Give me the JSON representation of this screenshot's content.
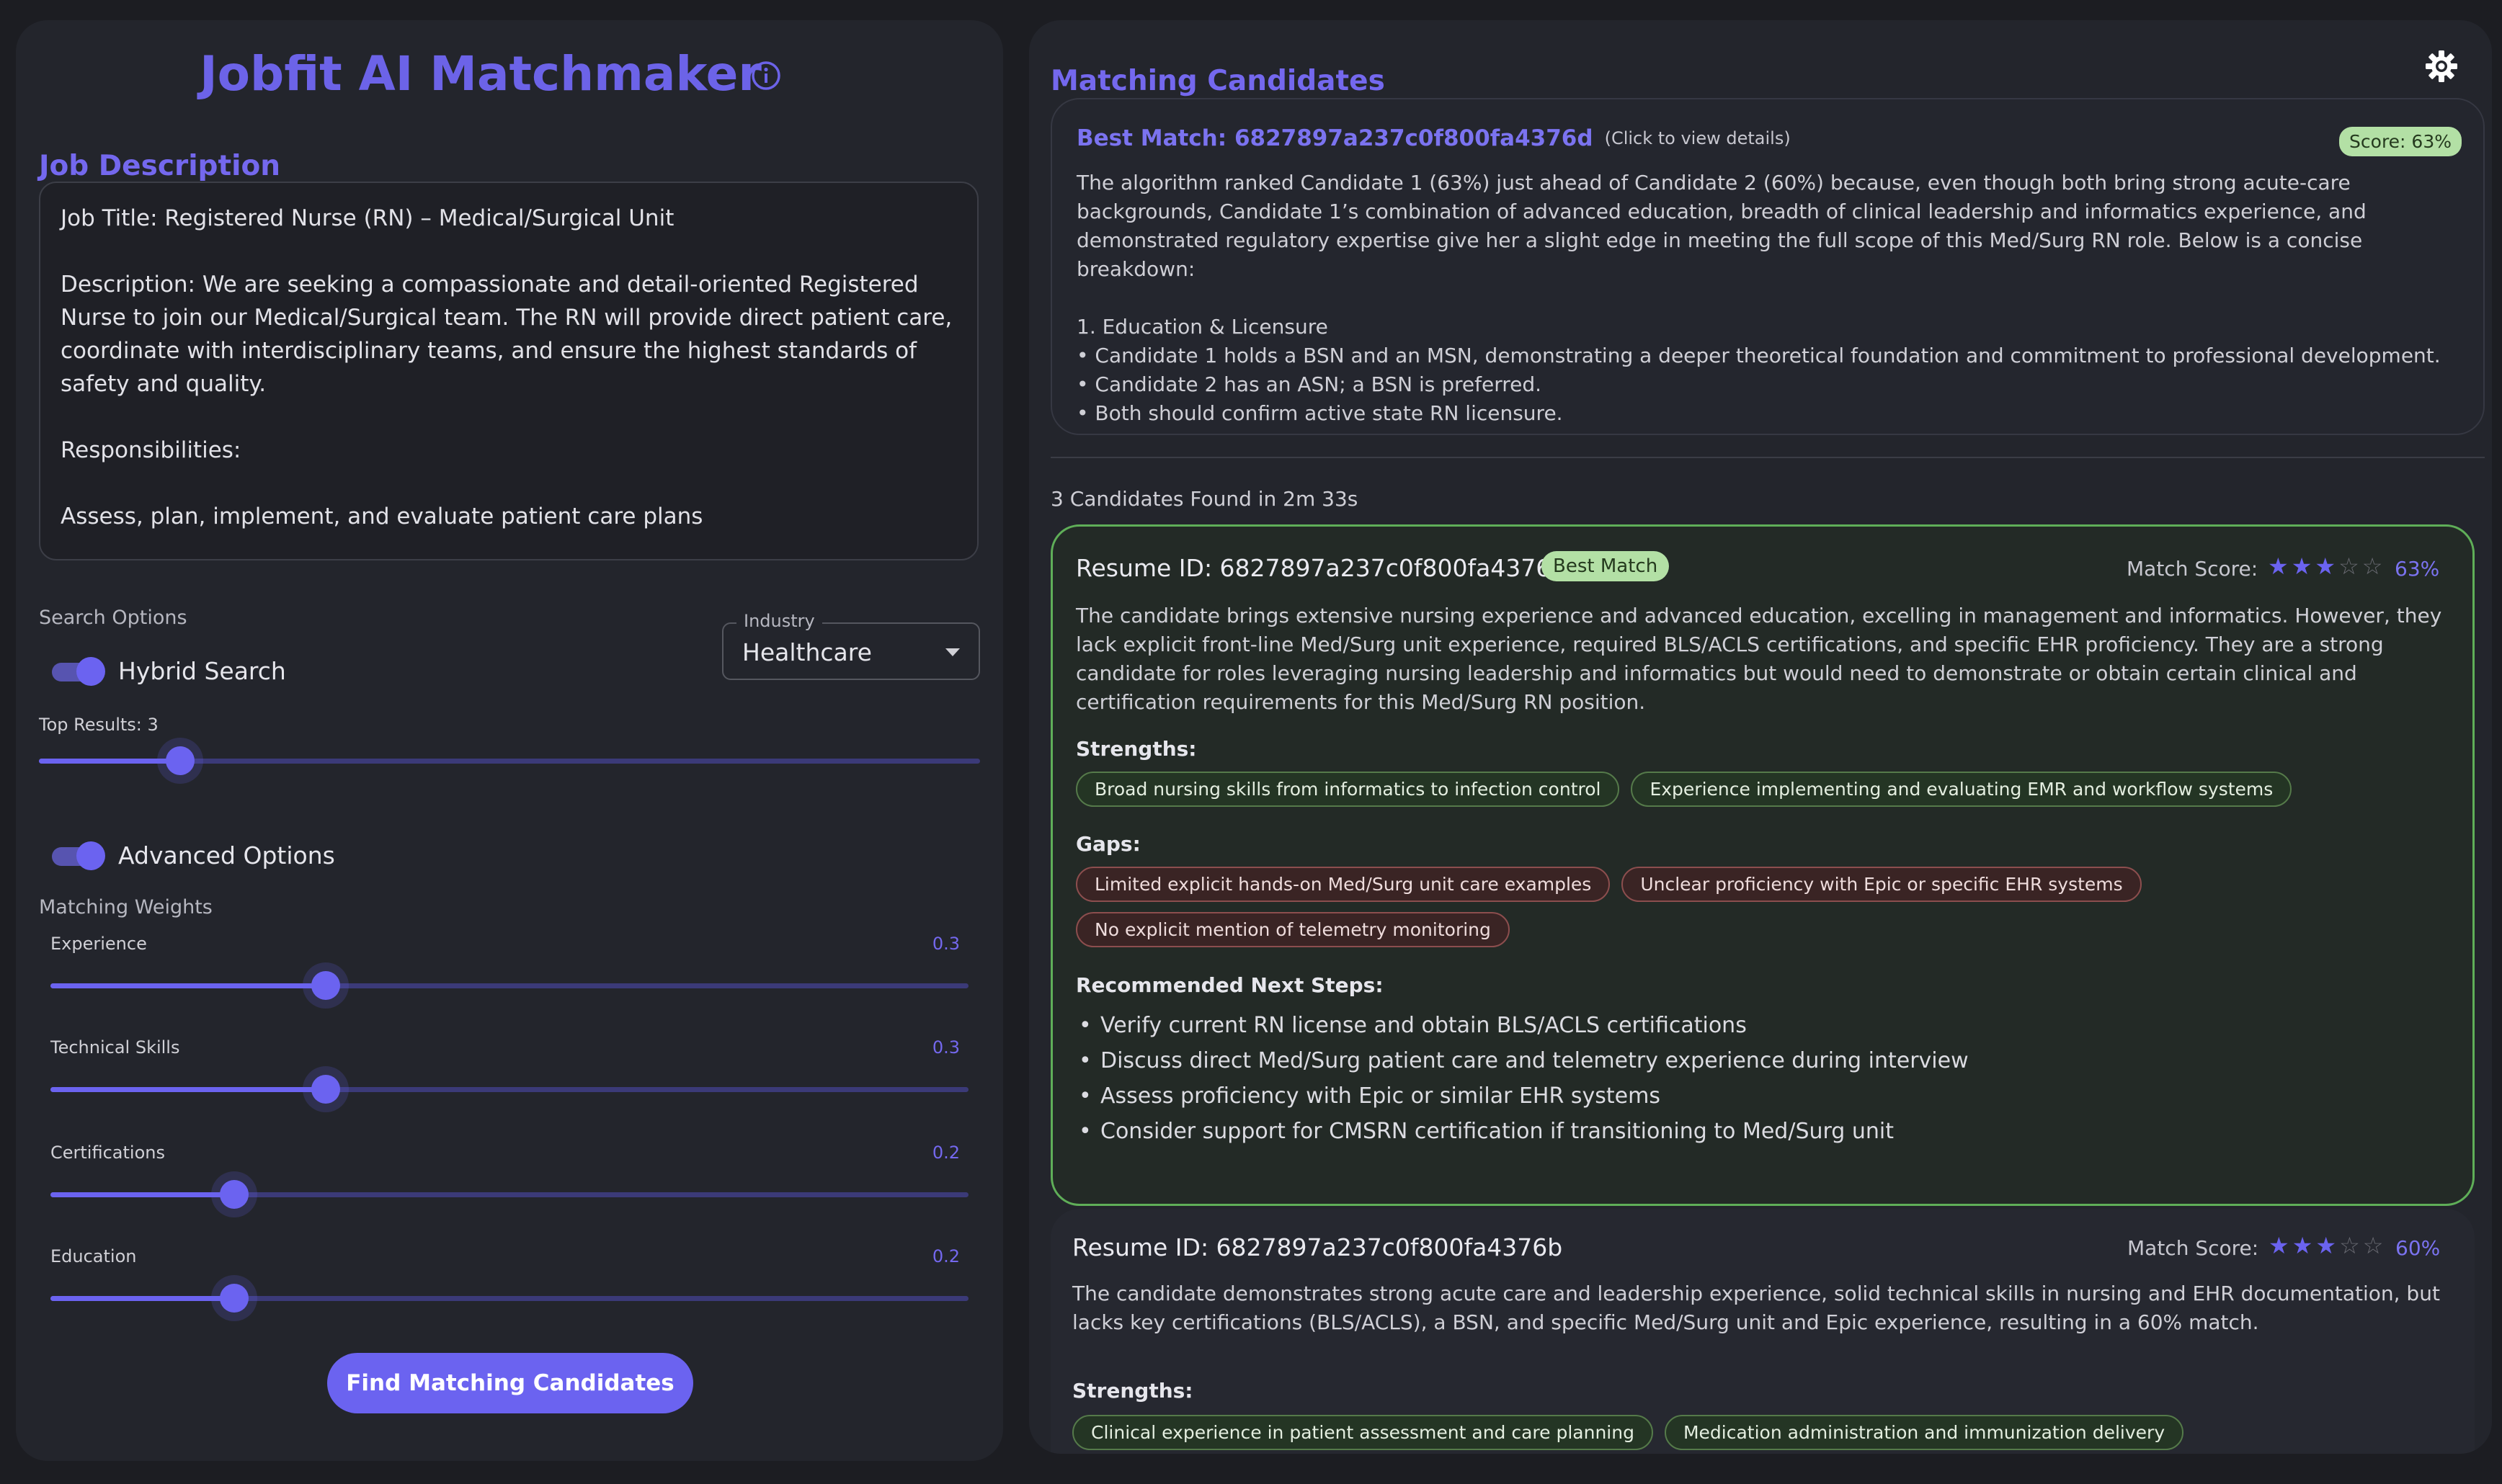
{
  "app": {
    "title": "Jobfit AI Matchmaker"
  },
  "job_description": {
    "heading": "Job Description",
    "text": "Job Title: Registered Nurse (RN) – Medical/Surgical Unit\n\nDescription: We are seeking a compassionate and detail-oriented Registered Nurse to join our Medical/Surgical team. The RN will provide direct patient care, coordinate with interdisciplinary teams, and ensure the highest standards of safety and quality.\n\nResponsibilities:\n\nAssess, plan, implement, and evaluate patient care plans"
  },
  "search_options": {
    "label": "Search Options",
    "hybrid_search_label": "Hybrid Search",
    "hybrid_search_on": true,
    "industry_legend": "Industry",
    "industry_value": "Healthcare",
    "top_results_label": "Top Results: 3",
    "top_results": 3,
    "top_results_max": 20,
    "advanced_options_label": "Advanced Options",
    "advanced_options_on": true
  },
  "weights": {
    "heading": "Matching Weights",
    "items": [
      {
        "label": "Experience",
        "value": "0.3",
        "fraction": 0.3
      },
      {
        "label": "Technical Skills",
        "value": "0.3",
        "fraction": 0.3
      },
      {
        "label": "Certifications",
        "value": "0.2",
        "fraction": 0.2
      },
      {
        "label": "Education",
        "value": "0.2",
        "fraction": 0.2
      }
    ]
  },
  "find_button": "Find Matching Candidates",
  "results": {
    "title": "Matching Candidates",
    "best_match": {
      "title": "Best Match: 6827897a237c0f800fa4376d",
      "hint": "(Click to view details)",
      "score": "Score: 63%",
      "text": "The algorithm ranked Candidate 1 (63%) just ahead of Candidate 2 (60%) because, even though both bring strong acute-care backgrounds, Candidate 1’s combination of advanced education, breadth of clinical leadership and informatics experience, and demonstrated regulatory expertise give her a slight edge in meeting the full scope of this Med/Surg RN role. Below is a concise breakdown:\n\n1. Education & Licensure\n• Candidate 1 holds a BSN and an MSN, demonstrating a deeper theoretical foundation and commitment to professional development.\n• Candidate 2 has an ASN; a BSN is preferred.\n• Both should confirm active state RN licensure."
    },
    "found_text": "3 Candidates Found in 2m 33s",
    "candidates": [
      {
        "resume_id": "Resume ID: 6827897a237c0f800fa4376d",
        "badge": "Best Match",
        "match_score_label": "Match Score:",
        "stars_filled": 3,
        "score": "63%",
        "description": "The candidate brings extensive nursing experience and advanced education, excelling in management and informatics. However, they lack explicit front-line Med/Surg unit experience, required BLS/ACLS certifications, and specific EHR proficiency. They are a strong candidate for roles leveraging nursing leadership and informatics but would need to demonstrate or obtain certain clinical and certification requirements for this Med/Surg RN position.",
        "strengths_label": "Strengths:",
        "strengths": [
          "Broad nursing skills from informatics to infection control",
          "Experience implementing and evaluating EMR and workflow systems"
        ],
        "gaps_label": "Gaps:",
        "gaps": [
          "Limited explicit hands-on Med/Surg unit care examples",
          "Unclear proficiency with Epic or specific EHR systems",
          "No explicit mention of telemetry monitoring"
        ],
        "steps_label": "Recommended Next Steps:",
        "steps": [
          "Verify current RN license and obtain BLS/ACLS certifications",
          "Discuss direct Med/Surg patient care and telemetry experience during interview",
          "Assess proficiency with Epic or similar EHR systems",
          "Consider support for CMSRN certification if transitioning to Med/Surg unit"
        ]
      },
      {
        "resume_id": "Resume ID: 6827897a237c0f800fa4376b",
        "match_score_label": "Match Score:",
        "stars_filled": 3,
        "score": "60%",
        "description": "The candidate demonstrates strong acute care and leadership experience, solid technical skills in nursing and EHR documentation, but lacks key certifications (BLS/ACLS), a BSN, and specific Med/Surg unit and Epic experience, resulting in a 60% match.",
        "strengths_label": "Strengths:",
        "strengths": [
          "Clinical experience in patient assessment and care planning",
          "Medication administration and immunization delivery"
        ]
      }
    ]
  },
  "colors": {
    "accent": "#6b63f0",
    "best_match_border": "#5fae58",
    "badge_green": "#b3e0a5"
  },
  "icons": [
    "info-icon",
    "settings-gear-icon",
    "star-icon",
    "dropdown-caret-icon"
  ]
}
